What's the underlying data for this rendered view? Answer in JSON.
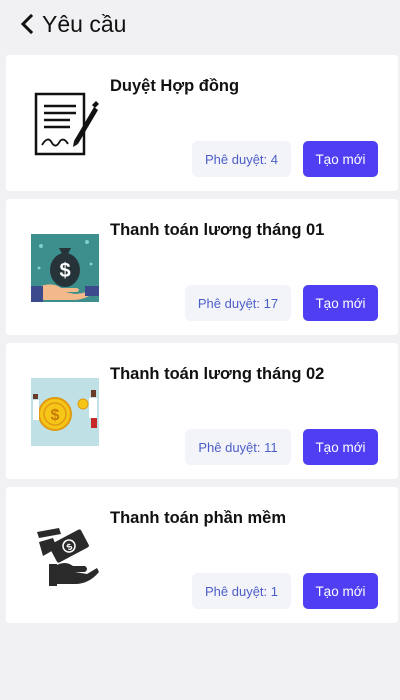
{
  "header": {
    "title": "Yêu cầu"
  },
  "requests": [
    {
      "title": "Duyệt Hợp đồng",
      "approve_label": "Phê duyệt: 4",
      "create_label": "Tạo mới"
    },
    {
      "title": "Thanh toán lương tháng 01",
      "approve_label": "Phê duyệt: 17",
      "create_label": "Tạo mới"
    },
    {
      "title": "Thanh toán lương tháng 02",
      "approve_label": "Phê duyệt: 11",
      "create_label": "Tạo mới"
    },
    {
      "title": "Thanh toán phần mềm",
      "approve_label": "Phê duyệt: 1",
      "create_label": "Tạo mới"
    }
  ],
  "colors": {
    "accent": "#4f3ef2",
    "badge_text": "#4b5ec8",
    "badge_bg": "#f3f4f9",
    "page_bg": "#f1f1f3"
  },
  "icons": [
    "chevron-left-icon",
    "contract-signing-icon",
    "money-bag-hand-icon",
    "coin-exchange-icon",
    "money-hand-icon"
  ]
}
